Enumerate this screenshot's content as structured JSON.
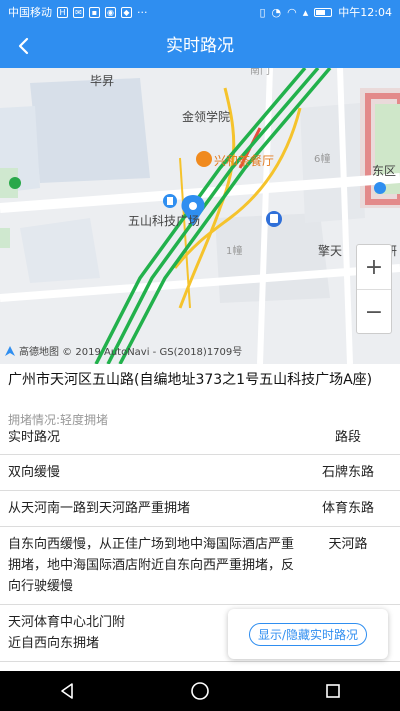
{
  "status_bar": {
    "carrier": "中国移动",
    "time": "中午12:04",
    "more": "···"
  },
  "header": {
    "title": "实时路况",
    "back_icon": "back-arrow-icon"
  },
  "map": {
    "labels": {
      "bisheng": "毕昇",
      "jinling": "金领学院",
      "restaurant": "兴和茶餐厅",
      "wushan_park": "五山科技广场",
      "building6": "6幢",
      "building1": "1幢",
      "dongqu": "东区",
      "qingtian": "擎天",
      "yan": "研",
      "nanmen": "南门"
    },
    "zoom_in": "+",
    "zoom_out": "−",
    "copyright": "高德地图 © 2019 AutoNavi - GS(2018)1709号"
  },
  "address": "广州市天河区五山路(自编地址373之1号五山科技广场A座)",
  "congestion": "拥堵情况:轻度拥堵",
  "table": {
    "header": {
      "status": "实时路况",
      "section": "路段"
    },
    "rows": [
      {
        "status": "双向缓慢",
        "section": "石牌东路"
      },
      {
        "status": "从天河南一路到天河路严重拥堵",
        "section": "体育东路"
      },
      {
        "status": "自东向西缓慢，从正佳广场到地中海国际酒店严重拥堵，地中海国际酒店附近自东向西严重拥堵，反向行驶缓慢",
        "section": "天河路"
      },
      {
        "status": "天河体育中心北门附近自西向东拥堵",
        "section": ""
      }
    ]
  },
  "toggle_button": "显示/隐藏实时路况",
  "colors": {
    "primary": "#2f8ef0",
    "traffic_green": "#22b14c",
    "road_yellow": "#f5c32c",
    "road_red": "#e64c3c"
  }
}
